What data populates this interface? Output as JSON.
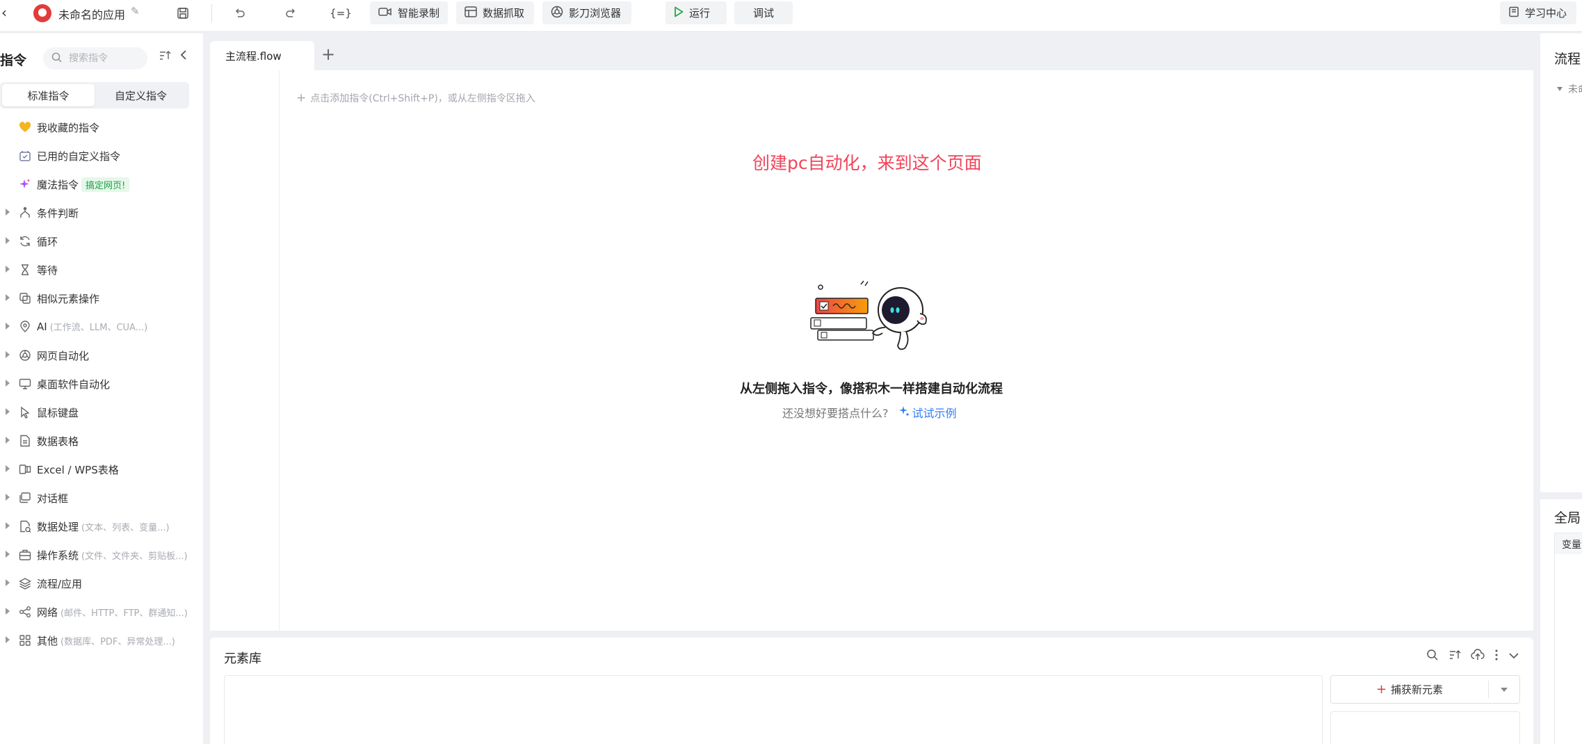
{
  "app": {
    "title": "未命名的应用"
  },
  "toolbar": {
    "buttons": [
      {
        "icon": "video-camera-icon",
        "label": "智能录制"
      },
      {
        "icon": "table-icon",
        "label": "数据抓取"
      },
      {
        "icon": "browser-icon",
        "label": "影刀浏览器"
      }
    ],
    "variables_label": "{=}",
    "run_label": "运行",
    "debug_label": "调试",
    "learn_label": "学习中心"
  },
  "sidebar": {
    "title": "指令",
    "search_placeholder": "搜索指令",
    "tabs": [
      {
        "label": "标准指令",
        "active": true
      },
      {
        "label": "自定义指令",
        "active": false
      }
    ],
    "items": [
      {
        "icon": "heart-icon",
        "label": "我收藏的指令",
        "hint": "",
        "expandable": false
      },
      {
        "icon": "custom-command-icon",
        "label": "已用的自定义指令",
        "hint": "",
        "expandable": false
      },
      {
        "icon": "sparkle-icon",
        "label": "魔法指令",
        "hint": "",
        "badge": "搞定网页!",
        "expandable": false
      },
      {
        "icon": "branch-icon",
        "label": "条件判断",
        "hint": "",
        "expandable": true
      },
      {
        "icon": "loop-icon",
        "label": "循环",
        "hint": "",
        "expandable": true
      },
      {
        "icon": "hourglass-icon",
        "label": "等待",
        "hint": "",
        "expandable": true
      },
      {
        "icon": "copy-icon",
        "label": "相似元素操作",
        "hint": "",
        "expandable": true
      },
      {
        "icon": "ai-icon",
        "label": "AI",
        "hint": "(工作流、LLM、CUA...)",
        "expandable": true
      },
      {
        "icon": "web-icon",
        "label": "网页自动化",
        "hint": "",
        "expandable": true
      },
      {
        "icon": "desktop-icon",
        "label": "桌面软件自动化",
        "hint": "",
        "expandable": true
      },
      {
        "icon": "cursor-icon",
        "label": "鼠标键盘",
        "hint": "",
        "expandable": true
      },
      {
        "icon": "sheet-icon",
        "label": "数据表格",
        "hint": "",
        "expandable": true
      },
      {
        "icon": "excel-icon",
        "label": "Excel / WPS表格",
        "hint": "",
        "expandable": true
      },
      {
        "icon": "dialog-icon",
        "label": "对话框",
        "hint": "",
        "expandable": true
      },
      {
        "icon": "data-process-icon",
        "label": "数据处理",
        "hint": "(文本、列表、变量...)",
        "expandable": true
      },
      {
        "icon": "toolbox-icon",
        "label": "操作系统",
        "hint": "(文件、文件夹、剪贴板...)",
        "expandable": true
      },
      {
        "icon": "layers-icon",
        "label": "流程/应用",
        "hint": "",
        "expandable": true
      },
      {
        "icon": "share-icon",
        "label": "网络",
        "hint": "(邮件、HTTP、FTP、群通知...)",
        "expandable": true
      },
      {
        "icon": "grid-icon",
        "label": "其他",
        "hint": "(数据库、PDF、异常处理...)",
        "expandable": true
      }
    ]
  },
  "editor": {
    "tab_label": "主流程.flow",
    "add_hint": "点击添加指令(Ctrl+Shift+P)，或从左侧指令区拖入",
    "annotation": "创建pc自动化，来到这个页面",
    "empty_title": "从左侧拖入指令，像搭积木一样搭建自动化流程",
    "empty_sub": "还没想好要搭点什么?",
    "empty_link": "试试示例"
  },
  "element_library": {
    "title": "元素库",
    "capture_label": "捕获新元素"
  },
  "right_panel": {
    "title": "流程",
    "tree_item": "未命",
    "title2": "全局",
    "table_header": "变量"
  },
  "colors": {
    "accent_red": "#e23b3b",
    "annotation": "#f0445a",
    "link_blue": "#2f7cf6",
    "badge_green": "#1d9f43"
  }
}
